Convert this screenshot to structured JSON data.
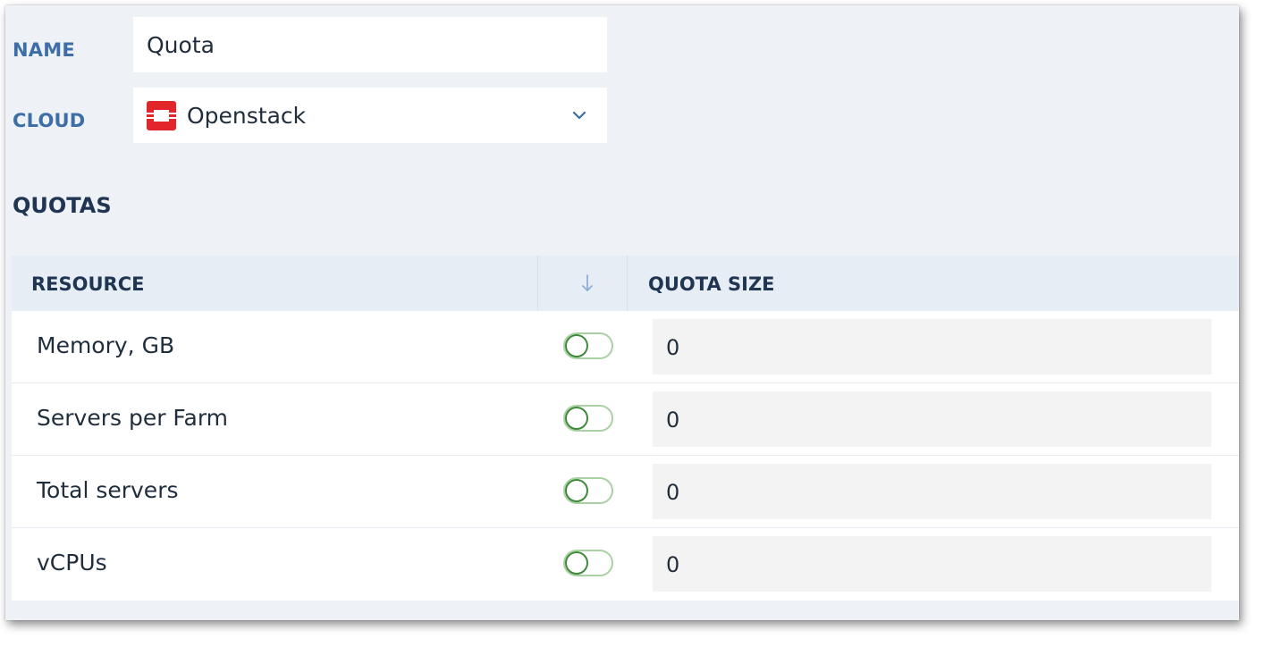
{
  "form": {
    "name_label": "NAME",
    "name_value": "Quota",
    "cloud_label": "CLOUD",
    "cloud_value": "Openstack",
    "cloud_icon": "openstack-logo-icon",
    "cloud_icon_color": "#e2252b"
  },
  "quotas": {
    "title": "QUOTAS",
    "columns": {
      "resource": "RESOURCE",
      "sort_icon": "arrow-down-icon",
      "quota_size": "QUOTA SIZE"
    },
    "rows": [
      {
        "resource": "Memory, GB",
        "enabled": false,
        "quota_size": "0"
      },
      {
        "resource": "Servers per Farm",
        "enabled": false,
        "quota_size": "0"
      },
      {
        "resource": "Total servers",
        "enabled": false,
        "quota_size": "0"
      },
      {
        "resource": "vCPUs",
        "enabled": false,
        "quota_size": "0"
      }
    ]
  },
  "colors": {
    "label_blue": "#3d6ea8",
    "heading": "#1f3551",
    "panel_bg": "#eef2f7",
    "toggle_green": "#3f8a3a"
  }
}
